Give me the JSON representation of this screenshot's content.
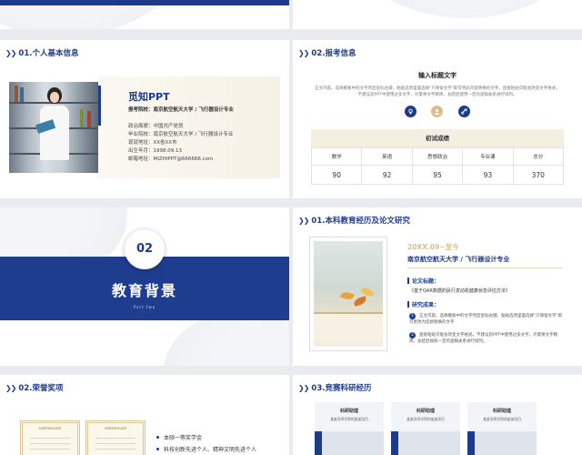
{
  "slide1": {
    "title": "01.个人基本信息",
    "name": "觅知PPT",
    "school_line": "报考院校：南京航空航天大学 / 飞行器设计专业",
    "info": [
      "政治面貌：中国共产党员",
      "毕业院校：南京航空航天大学 / 飞行器设计专业",
      "现就地址：XX省XX市",
      "出生年月：1998.09.13",
      "邮箱地址：MIZHIPPT@666666.com"
    ]
  },
  "slide2": {
    "title": "02.报考信息",
    "heading": "输入标题文字",
    "description": "正文内容。选择模板中的文字然后鼠标右键，粘贴选项里面选择\"只保留文字\"即可将此内容替换的文字，直接粘贴可能会改变文字格式，不建议您PPT中使用过多文字，尽量将文字精简，总结后使用一定的逻辑关系进行排列。",
    "scores_title": "初试成绩",
    "headers": [
      "数学",
      "英语",
      "思想政治",
      "专业课",
      "总分"
    ],
    "values": [
      "90",
      "92",
      "95",
      "93",
      "370"
    ],
    "colors": {
      "accent": "#1d3b8c",
      "gold": "#d6bf8f"
    }
  },
  "slide3": {
    "number": "02",
    "title": "教育背景",
    "subtitle": "Part two"
  },
  "slide4": {
    "title": "01.本科教育经历及论文研究",
    "date": "20XX.09~至今",
    "school": "南京航空航天大学 / 飞行器设计专业",
    "thesis_label": "论文标题：",
    "thesis": "《基于QAR数据的民行发动机健康状态评估方法》",
    "result_label": "研究成果：",
    "results": [
      "正文内容。选择模板中的文字然后鼠标右键。粘贴选项里面选择\"只保留文字\"即可更改为您想替换的文字",
      "直接粘贴可能会改变文字格式。不建议您PPT中使用过多文字。尽量将文字精简。总结后按照一定的逻辑关系进行排列。"
    ]
  },
  "slide5": {
    "title": "02.荣誉奖项",
    "cert_label": "CERTIFICATE",
    "items": [
      "本硕一等奖学金",
      "科技创新先进个人、精神文明先进个人"
    ]
  },
  "slide6": {
    "title": "03.竞赛科研经历",
    "cards": [
      {
        "title": "科研助理",
        "sub": "某某导师学院的某某项目"
      },
      {
        "title": "科研助理",
        "sub": "某某导师学院的某某项目"
      },
      {
        "title": "科研助理",
        "sub": "某某导师学院的某某项目"
      }
    ]
  }
}
